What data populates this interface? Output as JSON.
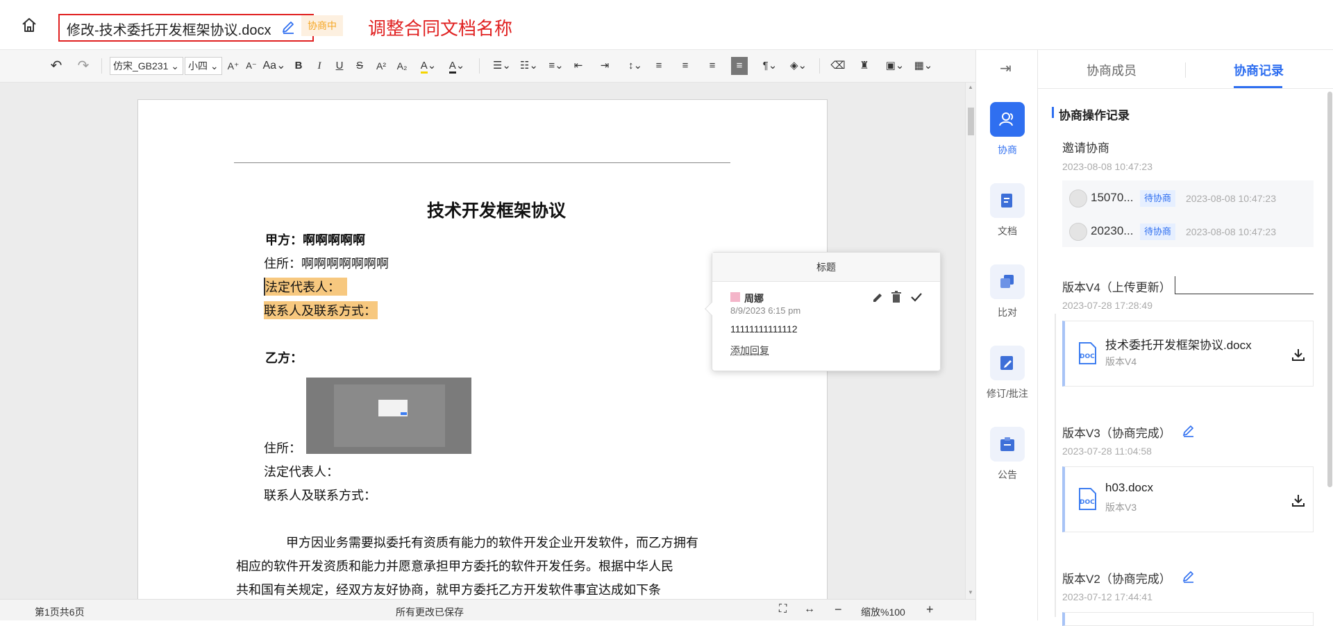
{
  "topbar": {
    "doc_title": "修改-技术委托开发框架协议.docx",
    "status_tag": "协商中",
    "annotation": "调整合同文档名称"
  },
  "toolbar": {
    "font_family": "仿宋_GB231",
    "font_size": "小四",
    "font_size_up": "A⁺",
    "font_size_down": "A⁻",
    "case": "Aa",
    "bold": "B",
    "italic": "I",
    "underline": "U",
    "strike": "S",
    "superscript": "A²",
    "subscript": "A₂",
    "highlight": "A",
    "font_color": "A",
    "paragraph": "¶"
  },
  "document": {
    "heading": "技术开发框架协议",
    "party_a_label": "甲方：",
    "party_a_value": "啊啊啊啊啊",
    "address_a": "住所：啊啊啊啊啊啊啊",
    "legal_rep_a": "法定代表人：",
    "contact_a": "联系人及联系方式：",
    "party_b_label": "乙方：",
    "address_b": "住所：",
    "legal_rep_b": "法定代表人：",
    "contact_b": "联系人及联系方式：",
    "para_line1": "甲方因业务需要拟委托有资质有能力的软件开发企业开发软件，而乙方拥有",
    "para_line2": "相应的软件开发资质和能力并愿意承担甲方委托的软件开发任务。根据中华人民",
    "para_line3": "共和国有关规定，经双方友好协商，就甲方委托乙方开发软件事宜达成如下条"
  },
  "comment": {
    "header": "标题",
    "author": "周娜",
    "datetime": "8/9/2023 6:15 pm",
    "text": "11111111111112",
    "reply_link": "添加回复",
    "author_color": "#f4b5c9"
  },
  "statusbar": {
    "page_info": "第1页共6页",
    "save_status": "所有更改已保存",
    "zoom_label": "缩放%100"
  },
  "side_nav": [
    {
      "label": "协商",
      "icon": "users-icon",
      "active": true
    },
    {
      "label": "文档",
      "icon": "document-icon",
      "active": false
    },
    {
      "label": "比对",
      "icon": "compare-icon",
      "active": false
    },
    {
      "label": "修订/批注",
      "icon": "revise-icon",
      "active": false
    },
    {
      "label": "公告",
      "icon": "notice-icon",
      "active": false
    }
  ],
  "panel": {
    "tabs": [
      "协商成员",
      "协商记录"
    ],
    "active_tab": "协商记录",
    "section_title": "协商操作记录",
    "invite": {
      "title": "邀请协商",
      "time": "2023-08-08 10:47:23",
      "members": [
        {
          "name": "15070...",
          "status": "待协商",
          "time": "2023-08-08 10:47:23"
        },
        {
          "name": "20230...",
          "status": "待协商",
          "time": "2023-08-08 10:47:23"
        }
      ]
    },
    "versions": [
      {
        "title": "版本V4（上传更新）",
        "time": "2023-07-28 17:28:49",
        "file": "技术委托开发框架协议.docx",
        "version": "版本V4"
      },
      {
        "title": "版本V3（协商完成）",
        "time": "2023-07-28 11:04:58",
        "file": "h03.docx",
        "version": "版本V3"
      },
      {
        "title": "版本V2（协商完成）",
        "time": "2023-07-12 17:44:41"
      }
    ]
  },
  "colors": {
    "accent": "#2f6ff0",
    "annotation_red": "#e02020",
    "status_orange": "#f5a623",
    "highlight": "#f7c87f"
  }
}
